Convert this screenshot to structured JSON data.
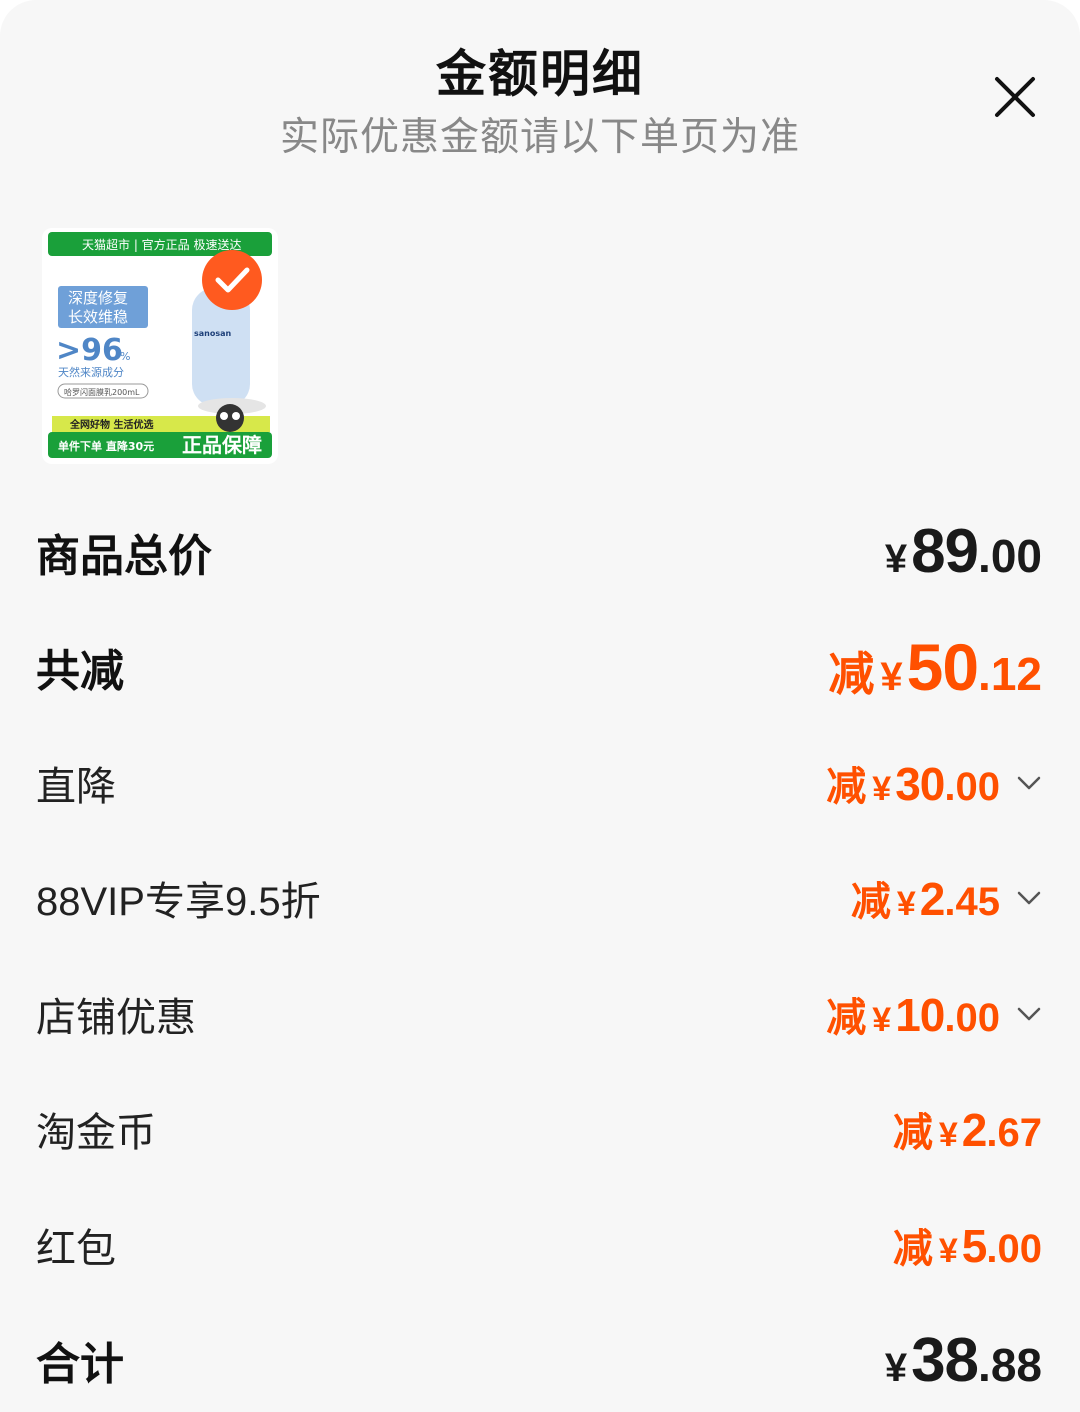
{
  "header": {
    "title": "金额明细",
    "subtitle": "实际优惠金额请以下单页为准"
  },
  "product": {
    "banner_top": "天猫超市 | 官方正品 极速送达",
    "tag_line1": "深度修复",
    "tag_line2": "长效维稳",
    "percent": ">96",
    "percent_unit": "%",
    "natural": "天然来源成分",
    "product_name": "哈罗闪面膜乳200mL",
    "brand": "sanosan",
    "footer_small": "全网好物 生活优选",
    "footer_deal": "单件下单 直降30元",
    "footer_guarantee": "正品保障"
  },
  "rows": [
    {
      "label": "商品总价",
      "prefix": "",
      "currency": "¥",
      "int": "89",
      "dec": ".00"
    },
    {
      "label": "共减",
      "prefix": "减",
      "currency": "¥",
      "int": "50",
      "dec": ".12"
    },
    {
      "label": "直降",
      "prefix": "减",
      "currency": "¥",
      "int": "30",
      "dec": ".00"
    },
    {
      "label": "88VIP专享9.5折",
      "prefix": "减",
      "currency": "¥",
      "int": "2",
      "dec": ".45"
    },
    {
      "label": "店铺优惠",
      "prefix": "减",
      "currency": "¥",
      "int": "10",
      "dec": ".00"
    },
    {
      "label": "淘金币",
      "prefix": "减",
      "currency": "¥",
      "int": "2",
      "dec": ".67"
    },
    {
      "label": "红包",
      "prefix": "减",
      "currency": "¥",
      "int": "5",
      "dec": ".00"
    },
    {
      "label": "合计",
      "prefix": "",
      "currency": "¥",
      "int": "38",
      "dec": ".88"
    }
  ],
  "icons": {
    "close": "close-icon",
    "expand": "chevron-down-icon",
    "selected": "check-icon"
  },
  "colors": {
    "accent": "#ff5000",
    "text": "#111111",
    "muted": "#888888",
    "badge_green": "#1aa03a"
  }
}
